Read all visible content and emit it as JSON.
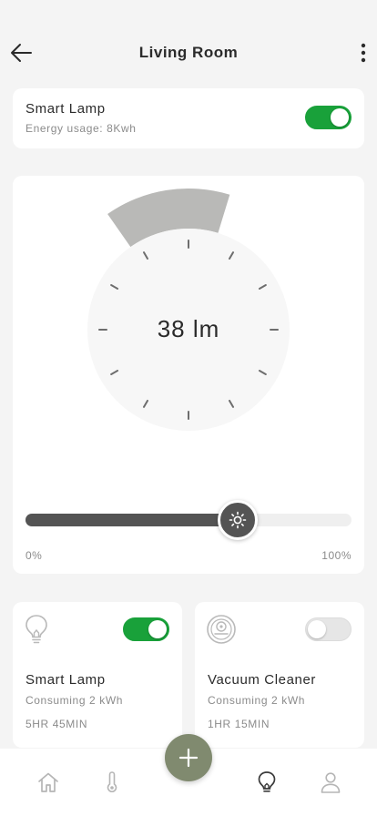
{
  "header": {
    "title": "Living Room",
    "back_icon": "arrow-left-icon",
    "menu_icon": "more-vertical-icon"
  },
  "main_device": {
    "name": "Smart Lamp",
    "energy": "Energy usage: 8Kwh",
    "on": true
  },
  "dial": {
    "value": 38,
    "unit": "lm",
    "display": "38 lm"
  },
  "slider": {
    "percent": 65,
    "min_label": "0%",
    "max_label": "100%",
    "thumb_icon": "sun-icon"
  },
  "devices": [
    {
      "name": "Smart Lamp",
      "consumption": "Consuming 2 kWh",
      "time": "5HR 45MIN",
      "on": true,
      "icon": "lightbulb-icon"
    },
    {
      "name": "Vacuum Cleaner",
      "consumption": "Consuming 2 kWh",
      "time": "1HR 15MIN",
      "on": false,
      "icon": "robot-vacuum-icon"
    }
  ],
  "bottom_nav": {
    "items": [
      "home-icon",
      "thermometer-icon",
      "lightbulb-icon",
      "user-icon"
    ],
    "fab_icon": "plus-icon"
  },
  "colors": {
    "toggle_on": "#19a13a",
    "accent": "#808a6f",
    "slider_fill": "#545454",
    "background": "#f4f4f4"
  }
}
